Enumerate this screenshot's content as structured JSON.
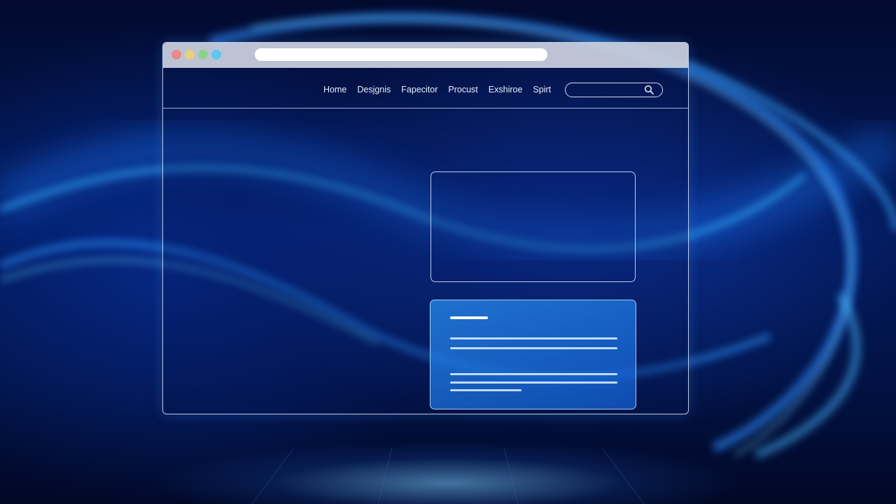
{
  "nav": {
    "links": [
      "Home",
      "Desjgnis",
      "Fapecitor",
      "Procust",
      "Exshiroe",
      "Spirt"
    ]
  },
  "search": {
    "placeholder": "",
    "icon": "search-icon"
  },
  "window_controls": {
    "colors": [
      "#e98a8a",
      "#e6d07a",
      "#8fd08f",
      "#5fc7ee"
    ]
  },
  "colors": {
    "background": "#031a5c",
    "accent": "#2a8cf0",
    "outline": "#dcebff"
  }
}
